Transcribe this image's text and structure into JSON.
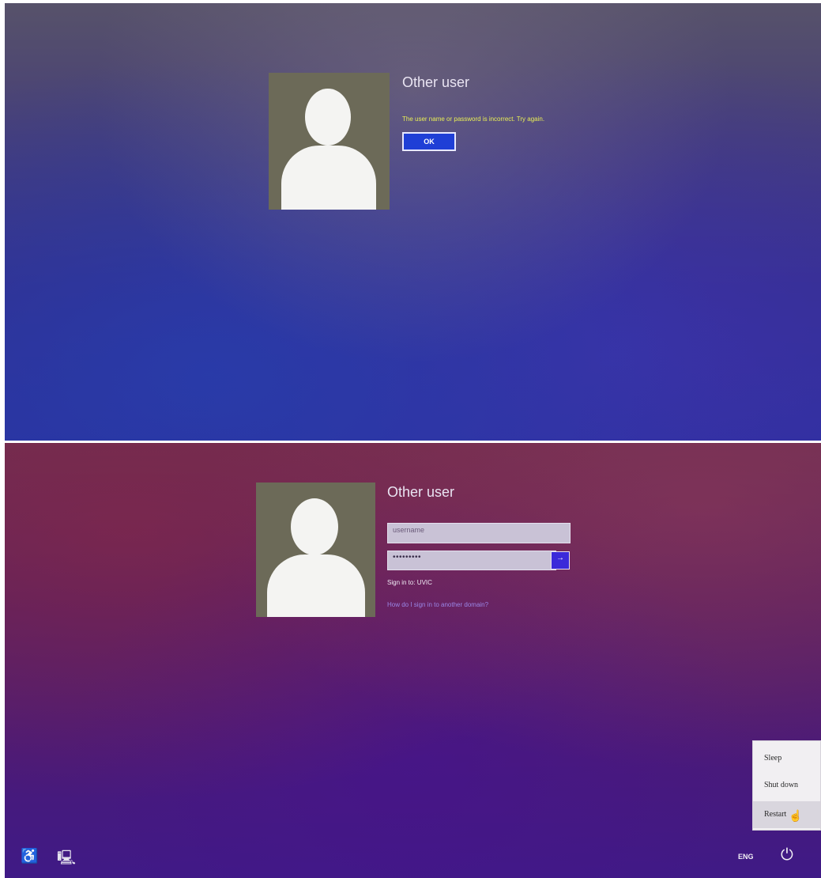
{
  "top_screen": {
    "user_title": "Other user",
    "error_message": "The user name or password is incorrect. Try again.",
    "ok_label": "OK"
  },
  "bottom_screen": {
    "user_title": "Other user",
    "username_value": "username",
    "password_value": "•••••••••",
    "submit_icon": "→",
    "sign_in_to": "Sign in to: UVIC",
    "domain_link": "How do I sign in to another domain?",
    "power_menu": {
      "items": [
        "Sleep",
        "Shut down",
        "Restart"
      ]
    },
    "language": "ENG",
    "ease_of_access_icon": "♿",
    "network_icon": "🖳",
    "power_icon": "⏻"
  },
  "colors": {
    "error_text": "#e8ee55",
    "ok_button": "#1f3fd6",
    "submit_button": "#3b2ad9",
    "link": "#9a86e6"
  }
}
